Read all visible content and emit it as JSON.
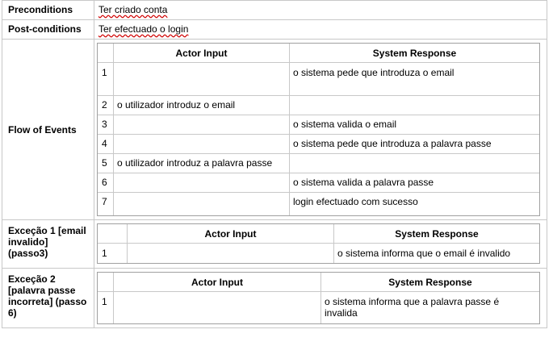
{
  "main_table": {
    "preconditions": {
      "label": "Preconditions",
      "value": "Ter criado conta"
    },
    "postconditions": {
      "label": "Post-conditions",
      "value": "Ter efectuado o login"
    },
    "flow_label": "Flow of Events",
    "exception1_label": "Exceção 1 [email invalido] (passo3)",
    "exception2_label": "Exceção 2 [palavra passe incorreta] (passo 6)"
  },
  "flow_table": {
    "headers": {
      "actor": "Actor Input",
      "system": "System Response"
    },
    "rows": [
      {
        "n": "1",
        "actor": "",
        "system": "o sistema pede que introduza o email"
      },
      {
        "n": "2",
        "actor": "o utilizador introduz o email",
        "system": ""
      },
      {
        "n": "3",
        "actor": "",
        "system": "o sistema valida o email"
      },
      {
        "n": "4",
        "actor": "",
        "system": "o sistema pede que introduza a palavra passe"
      },
      {
        "n": "5",
        "actor": "o utilizador introduz a palavra passe",
        "system": ""
      },
      {
        "n": "6",
        "actor": "",
        "system": "o sistema valida a palavra passe"
      },
      {
        "n": "7",
        "actor": "",
        "system": "login efectuado com sucesso"
      }
    ]
  },
  "exception1_table": {
    "headers": {
      "actor": "Actor Input",
      "system": "System Response"
    },
    "rows": [
      {
        "n": "1",
        "actor": "",
        "system": "o sistema informa que o email é invalido"
      }
    ]
  },
  "exception2_table": {
    "headers": {
      "actor": "Actor Input",
      "system": "System Response"
    },
    "rows": [
      {
        "n": "1",
        "actor": "",
        "system": "o sistema informa que a palavra passe é invalida"
      }
    ]
  }
}
